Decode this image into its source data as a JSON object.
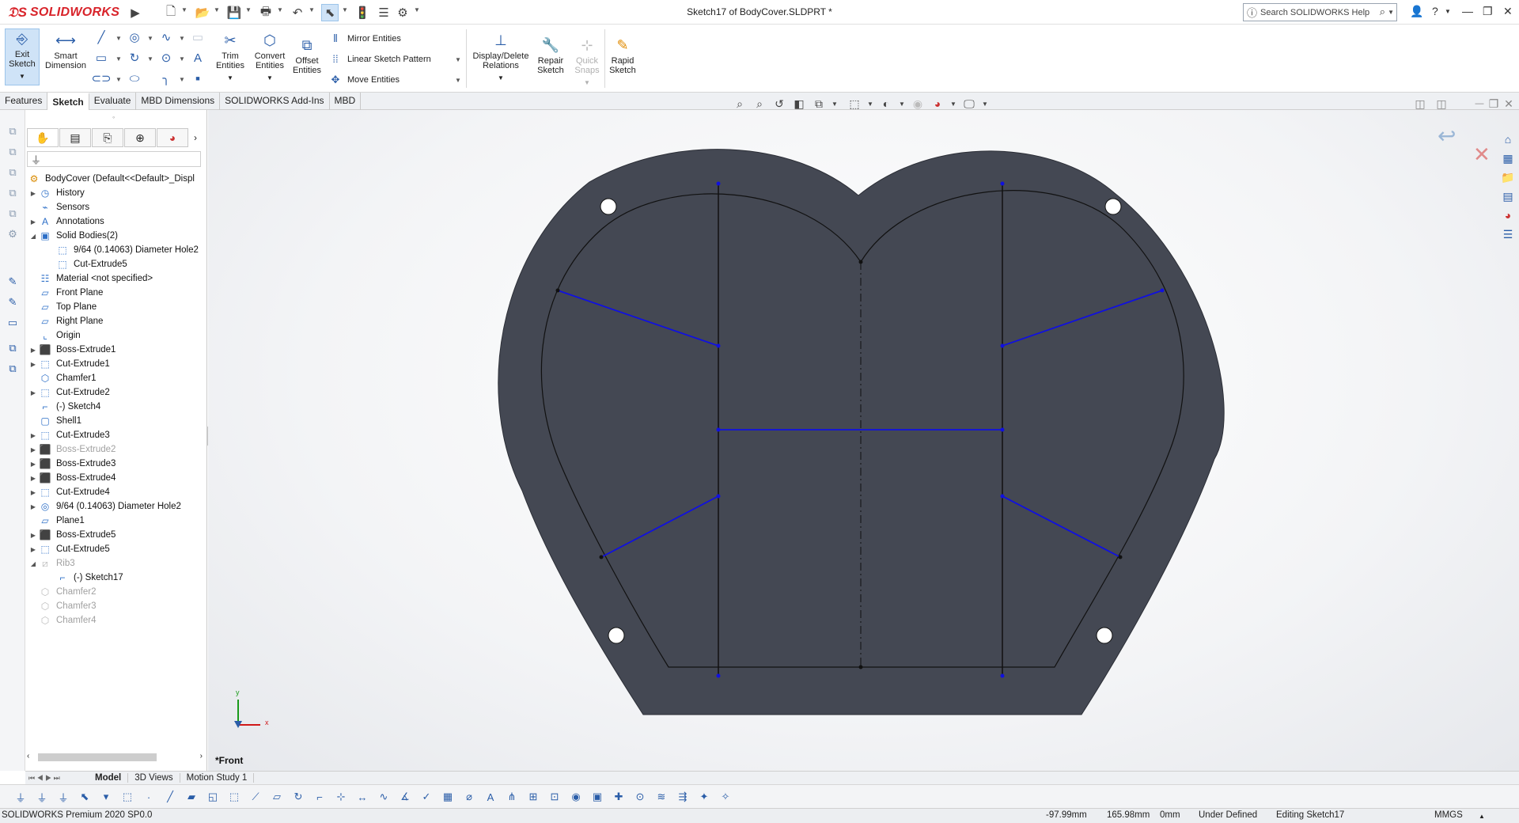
{
  "app": {
    "logo": "SOLIDWORKS",
    "doc_title": "Sketch17 of BodyCover.SLDPRT *",
    "search_placeholder": "Search SOLIDWORKS Help"
  },
  "colors": {
    "brand_red": "#d8232a",
    "part_fill": "#444853",
    "sketch_blue": "#1010e0",
    "sketch_black": "#111111",
    "accent_blue": "#2a5da8"
  },
  "command_manager": {
    "exit_sketch": "Exit\nSketch",
    "exit_sketch_l1": "Exit",
    "exit_sketch_l2": "Sketch",
    "smart_dim_l1": "Smart",
    "smart_dim_l2": "Dimension",
    "trim_l1": "Trim",
    "trim_l2": "Entities",
    "convert_l1": "Convert",
    "convert_l2": "Entities",
    "offset_l1": "Offset",
    "offset_l2": "Entities",
    "mirror": "Mirror Entities",
    "linear_pattern": "Linear Sketch Pattern",
    "move": "Move Entities",
    "display_delete_l1": "Display/Delete",
    "display_delete_l2": "Relations",
    "repair_l1": "Repair",
    "repair_l2": "Sketch",
    "quick_snaps_l1": "Quick",
    "quick_snaps_l2": "Snaps",
    "rapid_l1": "Rapid",
    "rapid_l2": "Sketch"
  },
  "tabs": [
    "Features",
    "Sketch",
    "Evaluate",
    "MBD Dimensions",
    "SOLIDWORKS Add-Ins",
    "MBD"
  ],
  "active_tab": "Sketch",
  "feature_tree": {
    "root": "BodyCover  (Default<<Default>_Displ",
    "items": [
      {
        "label": "History",
        "icon": "history-icon",
        "expand": true,
        "indent": 0,
        "gray": false
      },
      {
        "label": "Sensors",
        "icon": "sensor-icon",
        "expand": false,
        "indent": 0,
        "gray": false
      },
      {
        "label": "Annotations",
        "icon": "annotation-icon",
        "expand": true,
        "indent": 0,
        "gray": false
      },
      {
        "label": "Solid Bodies(2)",
        "icon": "solid-bodies-icon",
        "expand": "open",
        "indent": 0,
        "gray": false
      },
      {
        "label": "9/64 (0.14063) Diameter Hole2",
        "icon": "body-icon",
        "expand": false,
        "indent": 1,
        "gray": false
      },
      {
        "label": "Cut-Extrude5",
        "icon": "body-icon",
        "expand": false,
        "indent": 1,
        "gray": false
      },
      {
        "label": "Material <not specified>",
        "icon": "material-icon",
        "expand": false,
        "indent": 0,
        "gray": false
      },
      {
        "label": "Front Plane",
        "icon": "plane-icon",
        "expand": false,
        "indent": 0,
        "gray": false
      },
      {
        "label": "Top Plane",
        "icon": "plane-icon",
        "expand": false,
        "indent": 0,
        "gray": false
      },
      {
        "label": "Right Plane",
        "icon": "plane-icon",
        "expand": false,
        "indent": 0,
        "gray": false
      },
      {
        "label": "Origin",
        "icon": "origin-icon",
        "expand": false,
        "indent": 0,
        "gray": false
      },
      {
        "label": "Boss-Extrude1",
        "icon": "extrude-icon",
        "expand": true,
        "indent": 0,
        "gray": false
      },
      {
        "label": "Cut-Extrude1",
        "icon": "cut-icon",
        "expand": true,
        "indent": 0,
        "gray": false
      },
      {
        "label": "Chamfer1",
        "icon": "chamfer-icon",
        "expand": false,
        "indent": 0,
        "gray": false
      },
      {
        "label": "Cut-Extrude2",
        "icon": "cut-icon",
        "expand": true,
        "indent": 0,
        "gray": false
      },
      {
        "label": "(-) Sketch4",
        "icon": "sketch-icon",
        "expand": false,
        "indent": 0,
        "gray": false
      },
      {
        "label": "Shell1",
        "icon": "shell-icon",
        "expand": false,
        "indent": 0,
        "gray": false
      },
      {
        "label": "Cut-Extrude3",
        "icon": "cut-icon",
        "expand": true,
        "indent": 0,
        "gray": false
      },
      {
        "label": "Boss-Extrude2",
        "icon": "extrude-icon",
        "expand": true,
        "indent": 0,
        "gray": true
      },
      {
        "label": "Boss-Extrude3",
        "icon": "extrude-icon",
        "expand": true,
        "indent": 0,
        "gray": false
      },
      {
        "label": "Boss-Extrude4",
        "icon": "extrude-icon",
        "expand": true,
        "indent": 0,
        "gray": false
      },
      {
        "label": "Cut-Extrude4",
        "icon": "cut-icon",
        "expand": true,
        "indent": 0,
        "gray": false
      },
      {
        "label": "9/64 (0.14063) Diameter Hole2",
        "icon": "hole-icon",
        "expand": true,
        "indent": 0,
        "gray": false
      },
      {
        "label": "Plane1",
        "icon": "plane-icon",
        "expand": false,
        "indent": 0,
        "gray": false
      },
      {
        "label": "Boss-Extrude5",
        "icon": "extrude-icon",
        "expand": true,
        "indent": 0,
        "gray": false
      },
      {
        "label": "Cut-Extrude5",
        "icon": "cut-icon",
        "expand": true,
        "indent": 0,
        "gray": false
      },
      {
        "label": "Rib3",
        "icon": "rib-icon",
        "expand": "open",
        "indent": 0,
        "gray": true
      },
      {
        "label": "(-) Sketch17",
        "icon": "sketch-icon",
        "expand": false,
        "indent": 1,
        "gray": false
      },
      {
        "label": "Chamfer2",
        "icon": "chamfer-icon",
        "expand": false,
        "indent": 0,
        "gray": true
      },
      {
        "label": "Chamfer3",
        "icon": "chamfer-icon",
        "expand": false,
        "indent": 0,
        "gray": true
      },
      {
        "label": "Chamfer4",
        "icon": "chamfer-icon",
        "expand": false,
        "indent": 0,
        "gray": true
      }
    ]
  },
  "viewport": {
    "view_name": "*Front",
    "triad_x": "x",
    "triad_y": "y"
  },
  "bottom_tabs": [
    "Model",
    "3D Views",
    "Motion Study 1"
  ],
  "active_bottom_tab": "Model",
  "status": {
    "product": "SOLIDWORKS Premium 2020 SP0.0",
    "x": "-97.99mm",
    "y": "165.98mm",
    "z": "0mm",
    "state": "Under Defined",
    "editing": "Editing Sketch17",
    "units": "MMGS"
  }
}
